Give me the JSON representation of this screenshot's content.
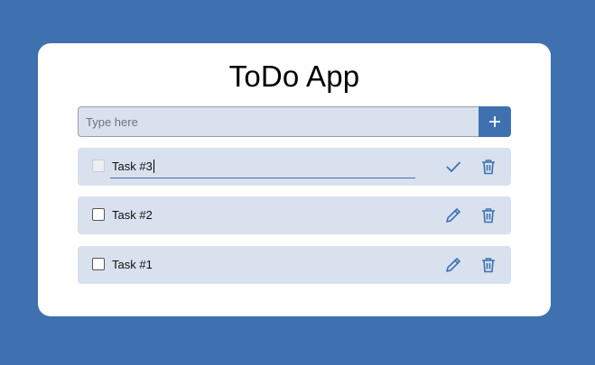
{
  "app": {
    "title": "ToDo App"
  },
  "new_task": {
    "placeholder": "Type here",
    "value": ""
  },
  "tasks": [
    {
      "label": "Task #3",
      "editing": true,
      "checked": false
    },
    {
      "label": "Task #2",
      "editing": false,
      "checked": false
    },
    {
      "label": "Task #1",
      "editing": false,
      "checked": false
    }
  ],
  "icons": {
    "add": "plus-icon",
    "confirm": "check-icon",
    "edit": "pencil-icon",
    "delete": "trash-icon"
  },
  "colors": {
    "background": "#3f71b0",
    "card": "#ffffff",
    "row": "#d9e0ee",
    "accent": "#3f71b0"
  }
}
